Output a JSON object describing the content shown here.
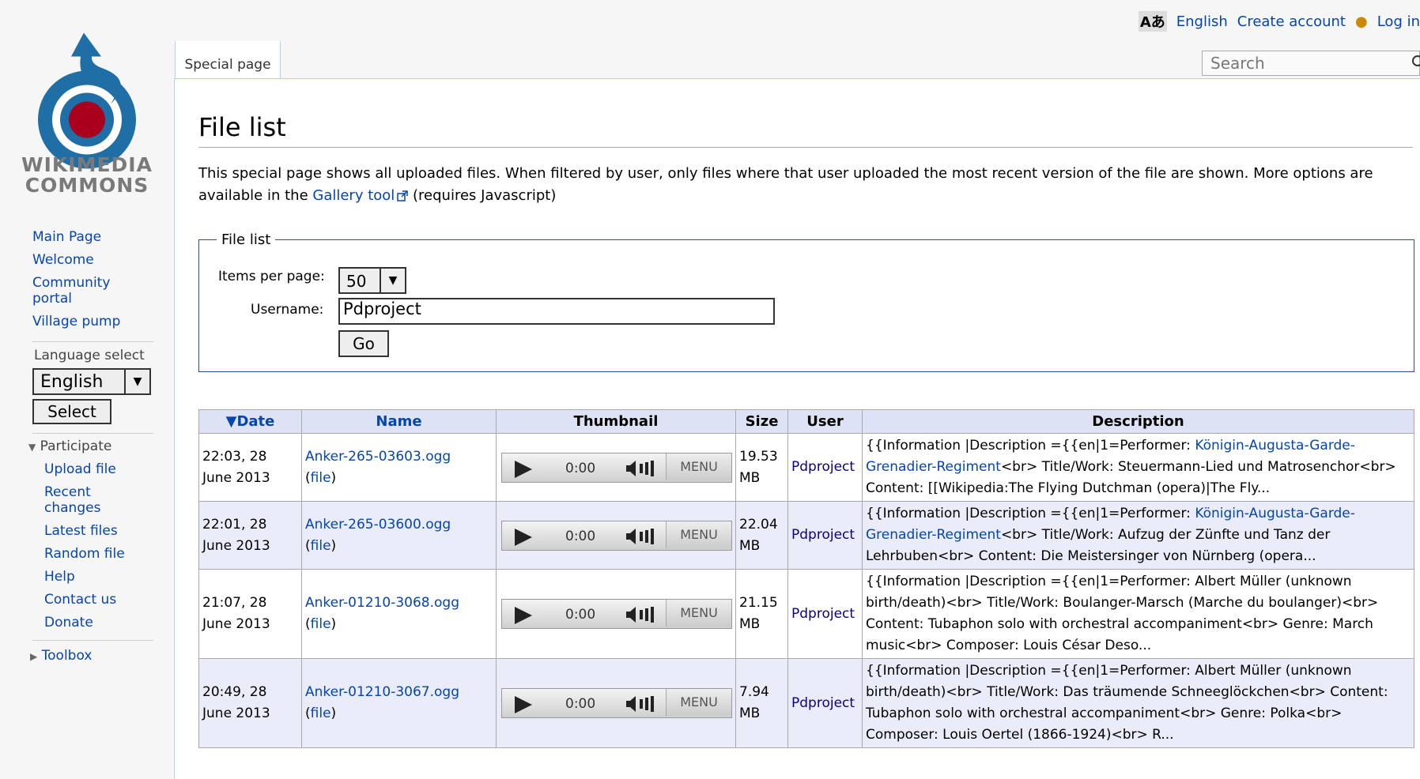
{
  "site": {
    "logo_line1": "WIKIMEDIA",
    "logo_line2": "COMMONS"
  },
  "personal": {
    "language": "English",
    "create_account": "Create account",
    "login": "Log in"
  },
  "tabs": {
    "special": "Special page"
  },
  "search": {
    "placeholder": "Search"
  },
  "sidebar": {
    "nav": [
      "Main Page",
      "Welcome",
      "Community portal",
      "Village pump"
    ],
    "language_select_label": "Language select",
    "language_value": "English",
    "select_button": "Select",
    "participate_label": "Participate",
    "participate": [
      "Upload file",
      "Recent changes",
      "Latest files",
      "Random file",
      "Help",
      "Contact us",
      "Donate"
    ],
    "toolbox_label": "Toolbox"
  },
  "page": {
    "title": "File list",
    "intro_text": "This special page shows all uploaded files. When filtered by user, only files where that user uploaded the most recent version of the file are shown. More options are available in the ",
    "intro_link": "Gallery tool",
    "intro_suffix": "(requires Javascript)"
  },
  "form": {
    "legend": "File list",
    "items_label": "Items per page:",
    "items_value": "50",
    "username_label": "Username:",
    "username_value": "Pdproject",
    "go": "Go"
  },
  "table": {
    "headers": [
      "▼Date",
      "Name",
      "Thumbnail",
      "Size",
      "User",
      "Description"
    ],
    "player": {
      "time": "0:00",
      "menu": "MENU"
    },
    "file_link": "file",
    "rows": [
      {
        "date": "22:03, 28 June 2013",
        "name": "Anker-265-03603.ogg",
        "size": "19.53 MB",
        "user": "Pdproject",
        "desc_pre": "{{Information |Description ={{en|1=Performer: ",
        "desc_link": "Königin-Augusta-Garde-Grenadier-Regiment",
        "desc_post": "<br> Title/Work: Steuermann-Lied und Matrosenchor<br> Content: [[Wikipedia:The Flying Dutchman (opera)|The Fly..."
      },
      {
        "date": "22:01, 28 June 2013",
        "name": "Anker-265-03600.ogg",
        "size": "22.04 MB",
        "user": "Pdproject",
        "desc_pre": "{{Information |Description ={{en|1=Performer: ",
        "desc_link": "Königin-Augusta-Garde-Grenadier-Regiment",
        "desc_post": "<br> Title/Work: Aufzug der Zünfte und Tanz der Lehrbuben<br> Content: Die Meistersinger von Nürnberg (opera..."
      },
      {
        "date": "21:07, 28 June 2013",
        "name": "Anker-01210-3068.ogg",
        "size": "21.15 MB",
        "user": "Pdproject",
        "desc_pre": "{{Information |Description ={{en|1=Performer: Albert Müller (unknown birth/death)<br> Title/Work: Boulanger-Marsch (Marche du boulanger)<br> Content: Tubaphon solo with orchestral accompaniment<br> Genre: March music<br> Composer: Louis César Deso...",
        "desc_link": "",
        "desc_post": ""
      },
      {
        "date": "20:49, 28 June 2013",
        "name": "Anker-01210-3067.ogg",
        "size": "7.94 MB",
        "user": "Pdproject",
        "desc_pre": "{{Information |Description ={{en|1=Performer: Albert Müller (unknown birth/death)<br> Title/Work: Das träumende Schneeglöckchen<br> Content: Tubaphon solo with orchestral accompaniment<br> Genre: Polka<br> Composer: Louis Oertel (1866-1924)<br> R...",
        "desc_link": "",
        "desc_post": ""
      }
    ]
  }
}
